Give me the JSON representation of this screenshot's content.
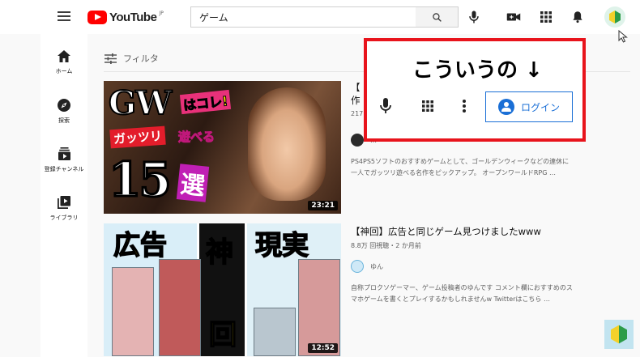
{
  "header": {
    "logo_text": "YouTube",
    "logo_region": "JP",
    "search_value": "ゲーム",
    "icons": [
      "menu-icon",
      "search-icon",
      "mic-icon",
      "create-video-icon",
      "apps-icon",
      "notifications-icon",
      "avatar-beginner-mark-icon"
    ]
  },
  "sidebar": {
    "items": [
      {
        "label": "ホーム",
        "icon": "home-icon"
      },
      {
        "label": "探索",
        "icon": "explore-icon"
      },
      {
        "label": "登録チャンネル",
        "icon": "subscriptions-icon"
      },
      {
        "label": "ライブラリ",
        "icon": "library-icon"
      }
    ]
  },
  "main": {
    "filter_label": "フィルタ",
    "videos": [
      {
        "title": "【",
        "title_line2": "作",
        "meta": "217",
        "channel": "…",
        "duration": "23:21",
        "description_lines": [
          "PS4PS5ソフトのおすすめゲームとして、ゴールデンウィークなどの連休に",
          "一人でガッツリ遊べる名作をピックアップ。 オープンワールドRPG …"
        ],
        "thumb_text": {
          "gw": "GW",
          "hakore": "はコレ!",
          "gatsuri": "ガッツリ",
          "asoberu": "遊べる",
          "num": "15",
          "sen": "選"
        }
      },
      {
        "title": "【神回】広告と同じゲーム見つけましたwww",
        "meta": "8.8万 回視聴・2 か月前",
        "channel": "ゆん",
        "duration": "12:52",
        "description_lines": [
          "自称プロクソゲーマー、ゲーム投稿者のゆんです コメント欄におすすめのス",
          "マホゲームを書くとプレイするかもしれませんw Twitterはこちら …"
        ],
        "thumb_text": {
          "kokoku": "広告",
          "kami": "神",
          "genjitsu": "現実",
          "kai": "回"
        }
      }
    ]
  },
  "callout": {
    "title": "こういうの ↓",
    "login_label": "ログイン",
    "icons": [
      "mic-icon",
      "apps-icon",
      "more-vert-icon",
      "account-circle-icon"
    ]
  },
  "colors": {
    "youtube_red": "#ff0000",
    "callout_border": "#e8141c",
    "login_blue": "#1a6fd6"
  }
}
